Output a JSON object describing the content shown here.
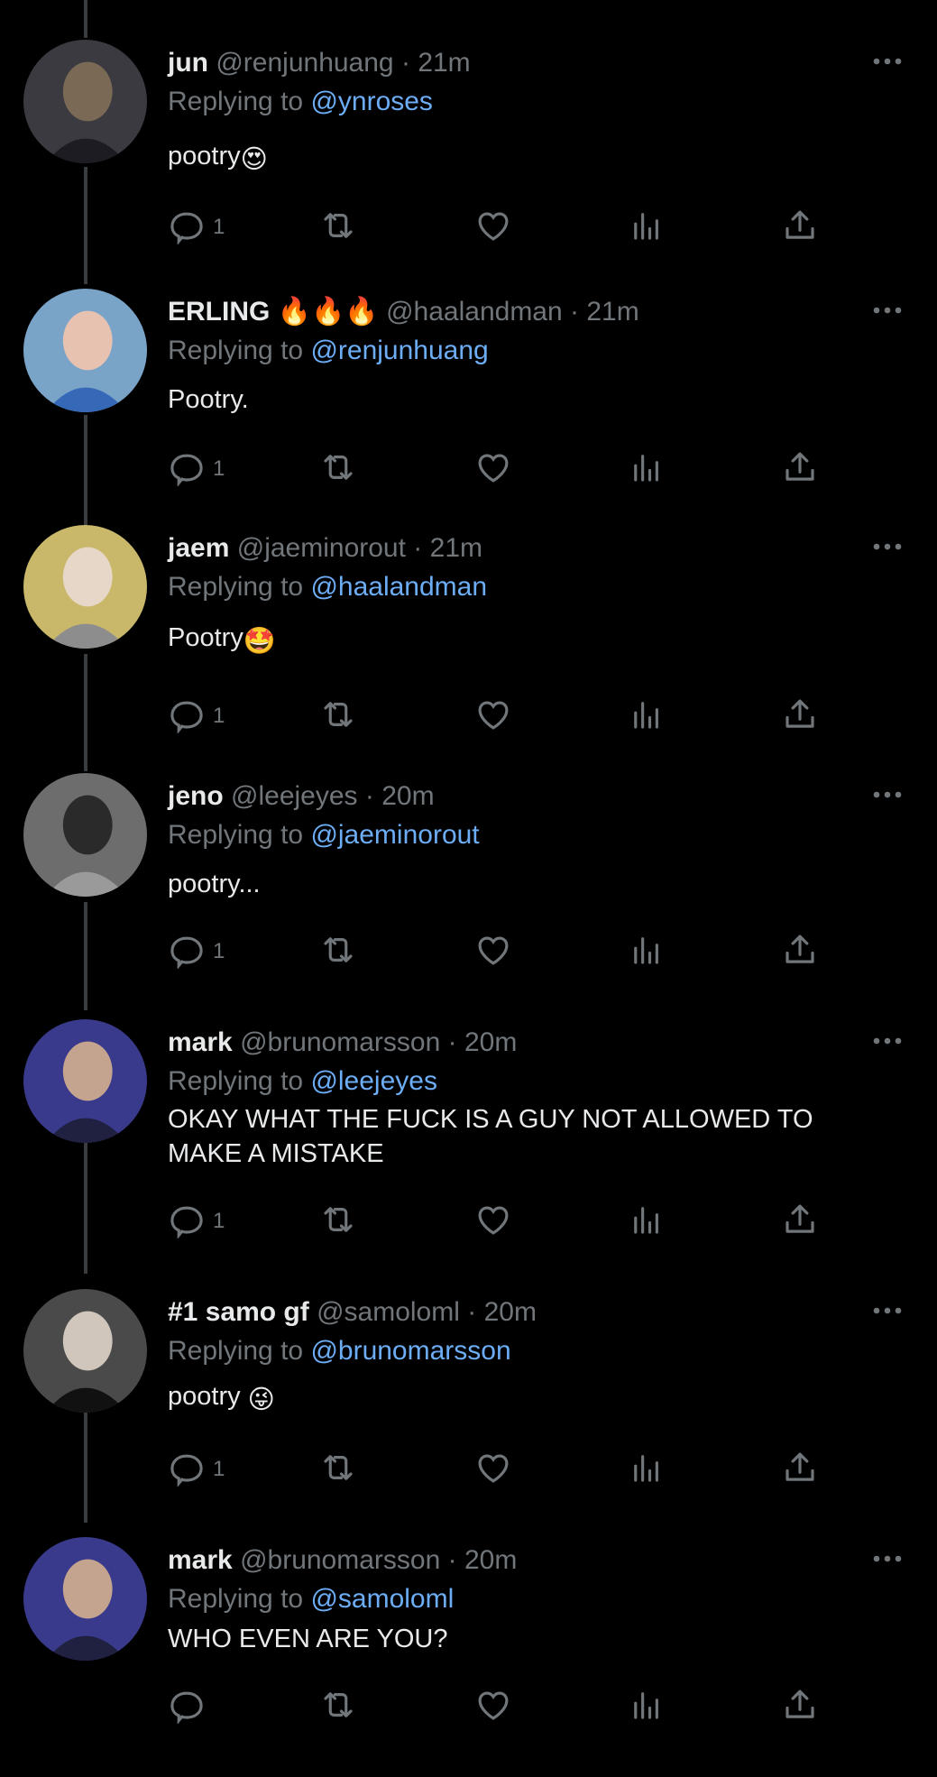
{
  "colors": {
    "background": "#000000",
    "text": "#e7e9ea",
    "muted": "#71767b",
    "mention": "#6cadf5",
    "thread_line": "#3a3d40"
  },
  "reply_prefix": "Replying to",
  "tweets": [
    {
      "name": "jun",
      "handle": "@renjunhuang",
      "time": "21m",
      "replying_to": "@ynroses",
      "text": "pootry",
      "emoji": "😍",
      "reply_count": "1"
    },
    {
      "name": "ERLING",
      "name_emoji": "🔥🔥🔥",
      "handle": "@haalandman",
      "time": "21m",
      "replying_to": "@renjunhuang",
      "text": "Pootry.",
      "reply_count": "1"
    },
    {
      "name": "jaem",
      "handle": "@jaeminorout",
      "time": "21m",
      "replying_to": "@haalandman",
      "text": "Pootry",
      "emoji": "🤩",
      "reply_count": "1"
    },
    {
      "name": "jeno",
      "handle": "@leejeyes",
      "time": "20m",
      "replying_to": "@jaeminorout",
      "text": "pootry...",
      "reply_count": "1"
    },
    {
      "name": "mark",
      "handle": "@brunomarsson",
      "time": "20m",
      "replying_to": "@leejeyes",
      "text": "OKAY WHAT THE FUCK IS A GUY NOT ALLOWED TO MAKE A MISTAKE",
      "reply_count": "1"
    },
    {
      "name": "#1 samo gf",
      "handle": "@samoloml",
      "time": "20m",
      "replying_to": "@brunomarsson",
      "text": "pootry ",
      "emoji": "😜",
      "reply_count": "1"
    },
    {
      "name": "mark",
      "handle": "@brunomarsson",
      "time": "20m",
      "replying_to": "@samoloml",
      "text": "WHO EVEN ARE YOU?",
      "reply_count": ""
    }
  ]
}
